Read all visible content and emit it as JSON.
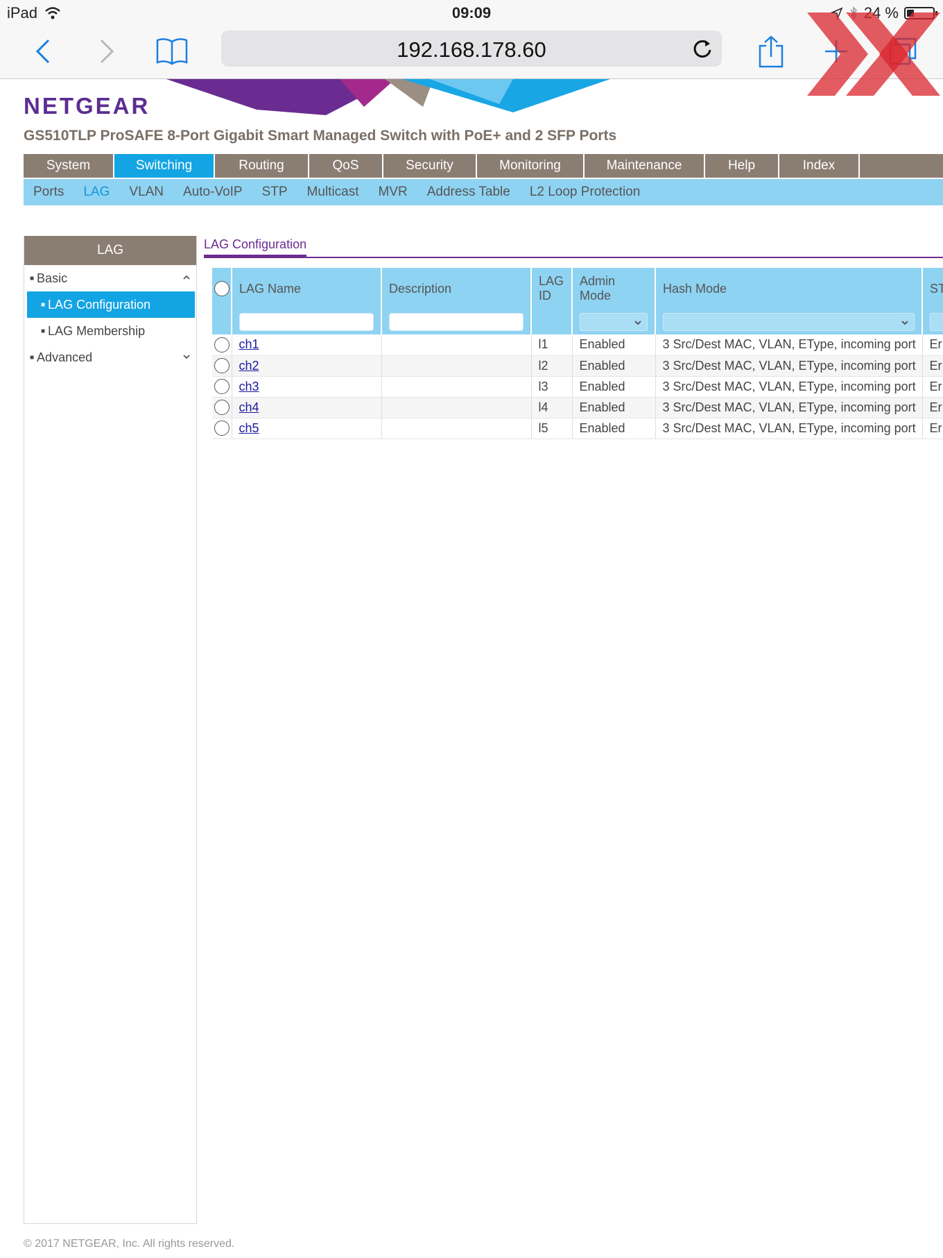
{
  "status_bar": {
    "device": "iPad",
    "time": "09:09",
    "battery": "24 %"
  },
  "browser": {
    "url": "192.168.178.60"
  },
  "header": {
    "logo": "NETGEAR",
    "product": "GS510TLP ProSAFE 8-Port Gigabit Smart Managed Switch with PoE+ and 2 SFP Ports"
  },
  "main_nav": [
    {
      "label": "System"
    },
    {
      "label": "Switching"
    },
    {
      "label": "Routing"
    },
    {
      "label": "QoS"
    },
    {
      "label": "Security"
    },
    {
      "label": "Monitoring"
    },
    {
      "label": "Maintenance"
    },
    {
      "label": "Help"
    },
    {
      "label": "Index"
    }
  ],
  "sub_nav": [
    {
      "label": "Ports"
    },
    {
      "label": "LAG"
    },
    {
      "label": "VLAN"
    },
    {
      "label": "Auto-VoIP"
    },
    {
      "label": "STP"
    },
    {
      "label": "Multicast"
    },
    {
      "label": "MVR"
    },
    {
      "label": "Address Table"
    },
    {
      "label": "L2 Loop Protection"
    }
  ],
  "sidebar": {
    "title": "LAG",
    "basic": "Basic",
    "lag_configuration": "LAG Configuration",
    "lag_membership": "LAG Membership",
    "advanced": "Advanced"
  },
  "content": {
    "tab_title": "LAG Configuration",
    "columns": {
      "lag_name": "LAG Name",
      "description": "Description",
      "lag_id": "LAG ID",
      "admin_mode": "Admin Mode",
      "hash_mode": "Hash Mode",
      "next": "ST"
    },
    "rows": [
      {
        "name": "ch1",
        "description": "",
        "lag_id": "l1",
        "admin_mode": "Enabled",
        "hash_mode": "3 Src/Dest MAC, VLAN, EType, incoming port",
        "next": "Er"
      },
      {
        "name": "ch2",
        "description": "",
        "lag_id": "l2",
        "admin_mode": "Enabled",
        "hash_mode": "3 Src/Dest MAC, VLAN, EType, incoming port",
        "next": "Er"
      },
      {
        "name": "ch3",
        "description": "",
        "lag_id": "l3",
        "admin_mode": "Enabled",
        "hash_mode": "3 Src/Dest MAC, VLAN, EType, incoming port",
        "next": "Er"
      },
      {
        "name": "ch4",
        "description": "",
        "lag_id": "l4",
        "admin_mode": "Enabled",
        "hash_mode": "3 Src/Dest MAC, VLAN, EType, incoming port",
        "next": "Er"
      },
      {
        "name": "ch5",
        "description": "",
        "lag_id": "l5",
        "admin_mode": "Enabled",
        "hash_mode": "3 Src/Dest MAC, VLAN, EType, incoming port",
        "next": "Er"
      }
    ]
  },
  "footer": "© 2017 NETGEAR, Inc. All rights reserved.",
  "colors": {
    "nav_bg": "#8a7d72",
    "active_blue": "#13a4e3",
    "subnav_bg": "#8fd3f2",
    "brand_purple": "#5c2d91"
  }
}
